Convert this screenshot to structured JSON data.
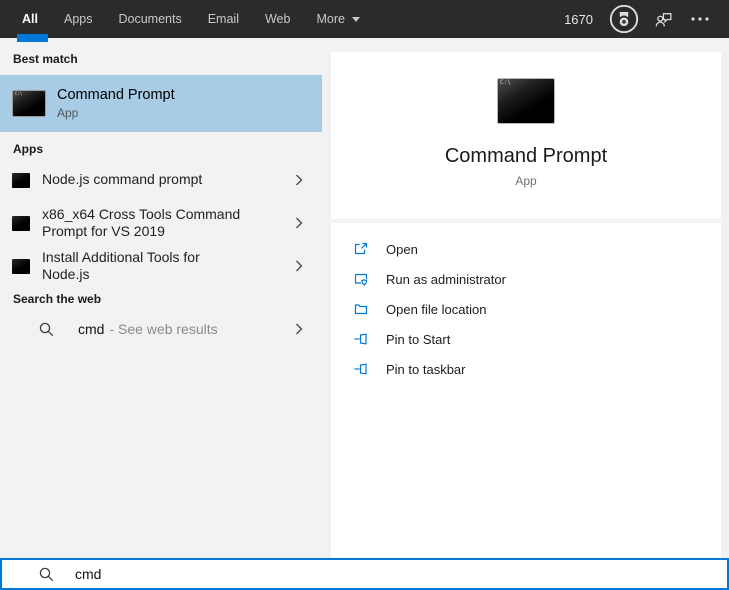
{
  "topbar": {
    "tabs": [
      {
        "label": "All",
        "active": true
      },
      {
        "label": "Apps"
      },
      {
        "label": "Documents"
      },
      {
        "label": "Email"
      },
      {
        "label": "Web"
      },
      {
        "label": "More"
      }
    ],
    "rewards_points": "1670"
  },
  "left_panel": {
    "best_match_header": "Best match",
    "best_match": {
      "title": "Command Prompt",
      "subtitle": "App"
    },
    "apps_header": "Apps",
    "apps": [
      {
        "label": "Node.js command prompt"
      },
      {
        "label": "x86_x64 Cross Tools Command Prompt for VS 2019"
      },
      {
        "label": "Install Additional Tools for Node.js"
      }
    ],
    "web_header": "Search the web",
    "web_item": {
      "query": "cmd",
      "suffix": "- See web results"
    }
  },
  "preview": {
    "title": "Command Prompt",
    "subtitle": "App",
    "actions": [
      {
        "label": "Open"
      },
      {
        "label": "Run as administrator"
      },
      {
        "label": "Open file location"
      },
      {
        "label": "Pin to Start"
      },
      {
        "label": "Pin to taskbar"
      }
    ]
  },
  "search_bar": {
    "value": "cmd"
  },
  "icons": {
    "cmd_window_text": "C:\\"
  },
  "colors": {
    "accent": "#0078d7",
    "topbar_bg": "#2b2b2b",
    "page_bg": "#f2f2f2",
    "highlight": "#a8cbe6",
    "card_bg": "#ffffff"
  }
}
